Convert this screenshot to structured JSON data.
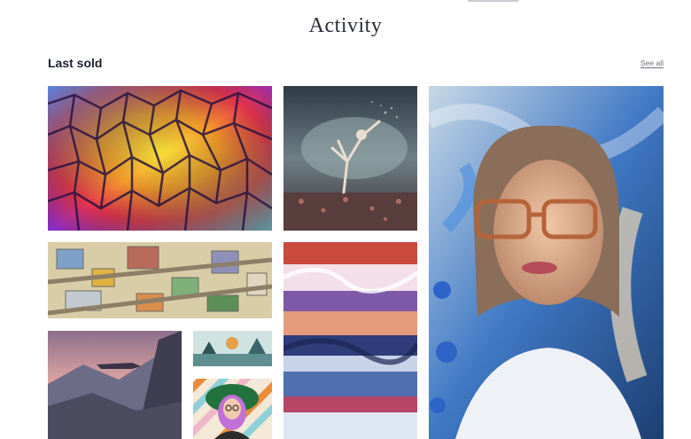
{
  "page": {
    "title": "Activity"
  },
  "section": {
    "title": "Last sold",
    "see_all_label": "See all"
  },
  "artworks": [
    {
      "id": "abstract-voronoi"
    },
    {
      "id": "dancer-in-storm"
    },
    {
      "id": "isometric-city"
    },
    {
      "id": "glitch-landscape"
    },
    {
      "id": "woman-with-glasses-portrait"
    },
    {
      "id": "mountain-airship"
    },
    {
      "id": "small-scene"
    },
    {
      "id": "green-hat-girl"
    }
  ]
}
